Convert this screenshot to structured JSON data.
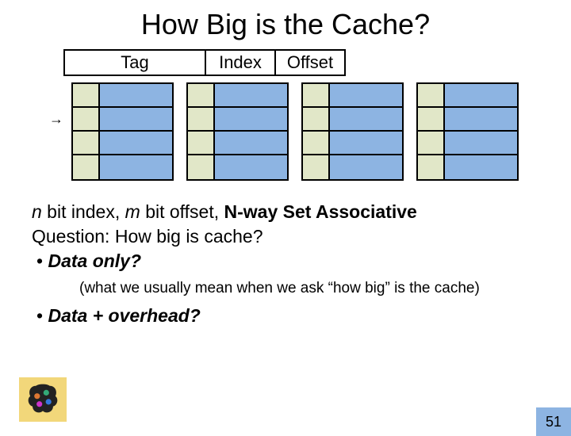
{
  "title": "How Big is the Cache?",
  "addr": {
    "tag": "Tag",
    "index": "Index",
    "offset": "Offset"
  },
  "text": {
    "line1_pre": "n",
    "line1_mid1": " bit index, ",
    "line1_m": "m",
    "line1_mid2": " bit offset, ",
    "line1_bold": "N-way Set Associative",
    "line2": "Question: How big is cache?",
    "bullet1_marker": "• ",
    "bullet1": "Data only?",
    "paren": "(what we usually mean when we ask “how big” is the cache)",
    "bullet2_marker": "• ",
    "bullet2": "Data + overhead?"
  },
  "pagenum": "51"
}
